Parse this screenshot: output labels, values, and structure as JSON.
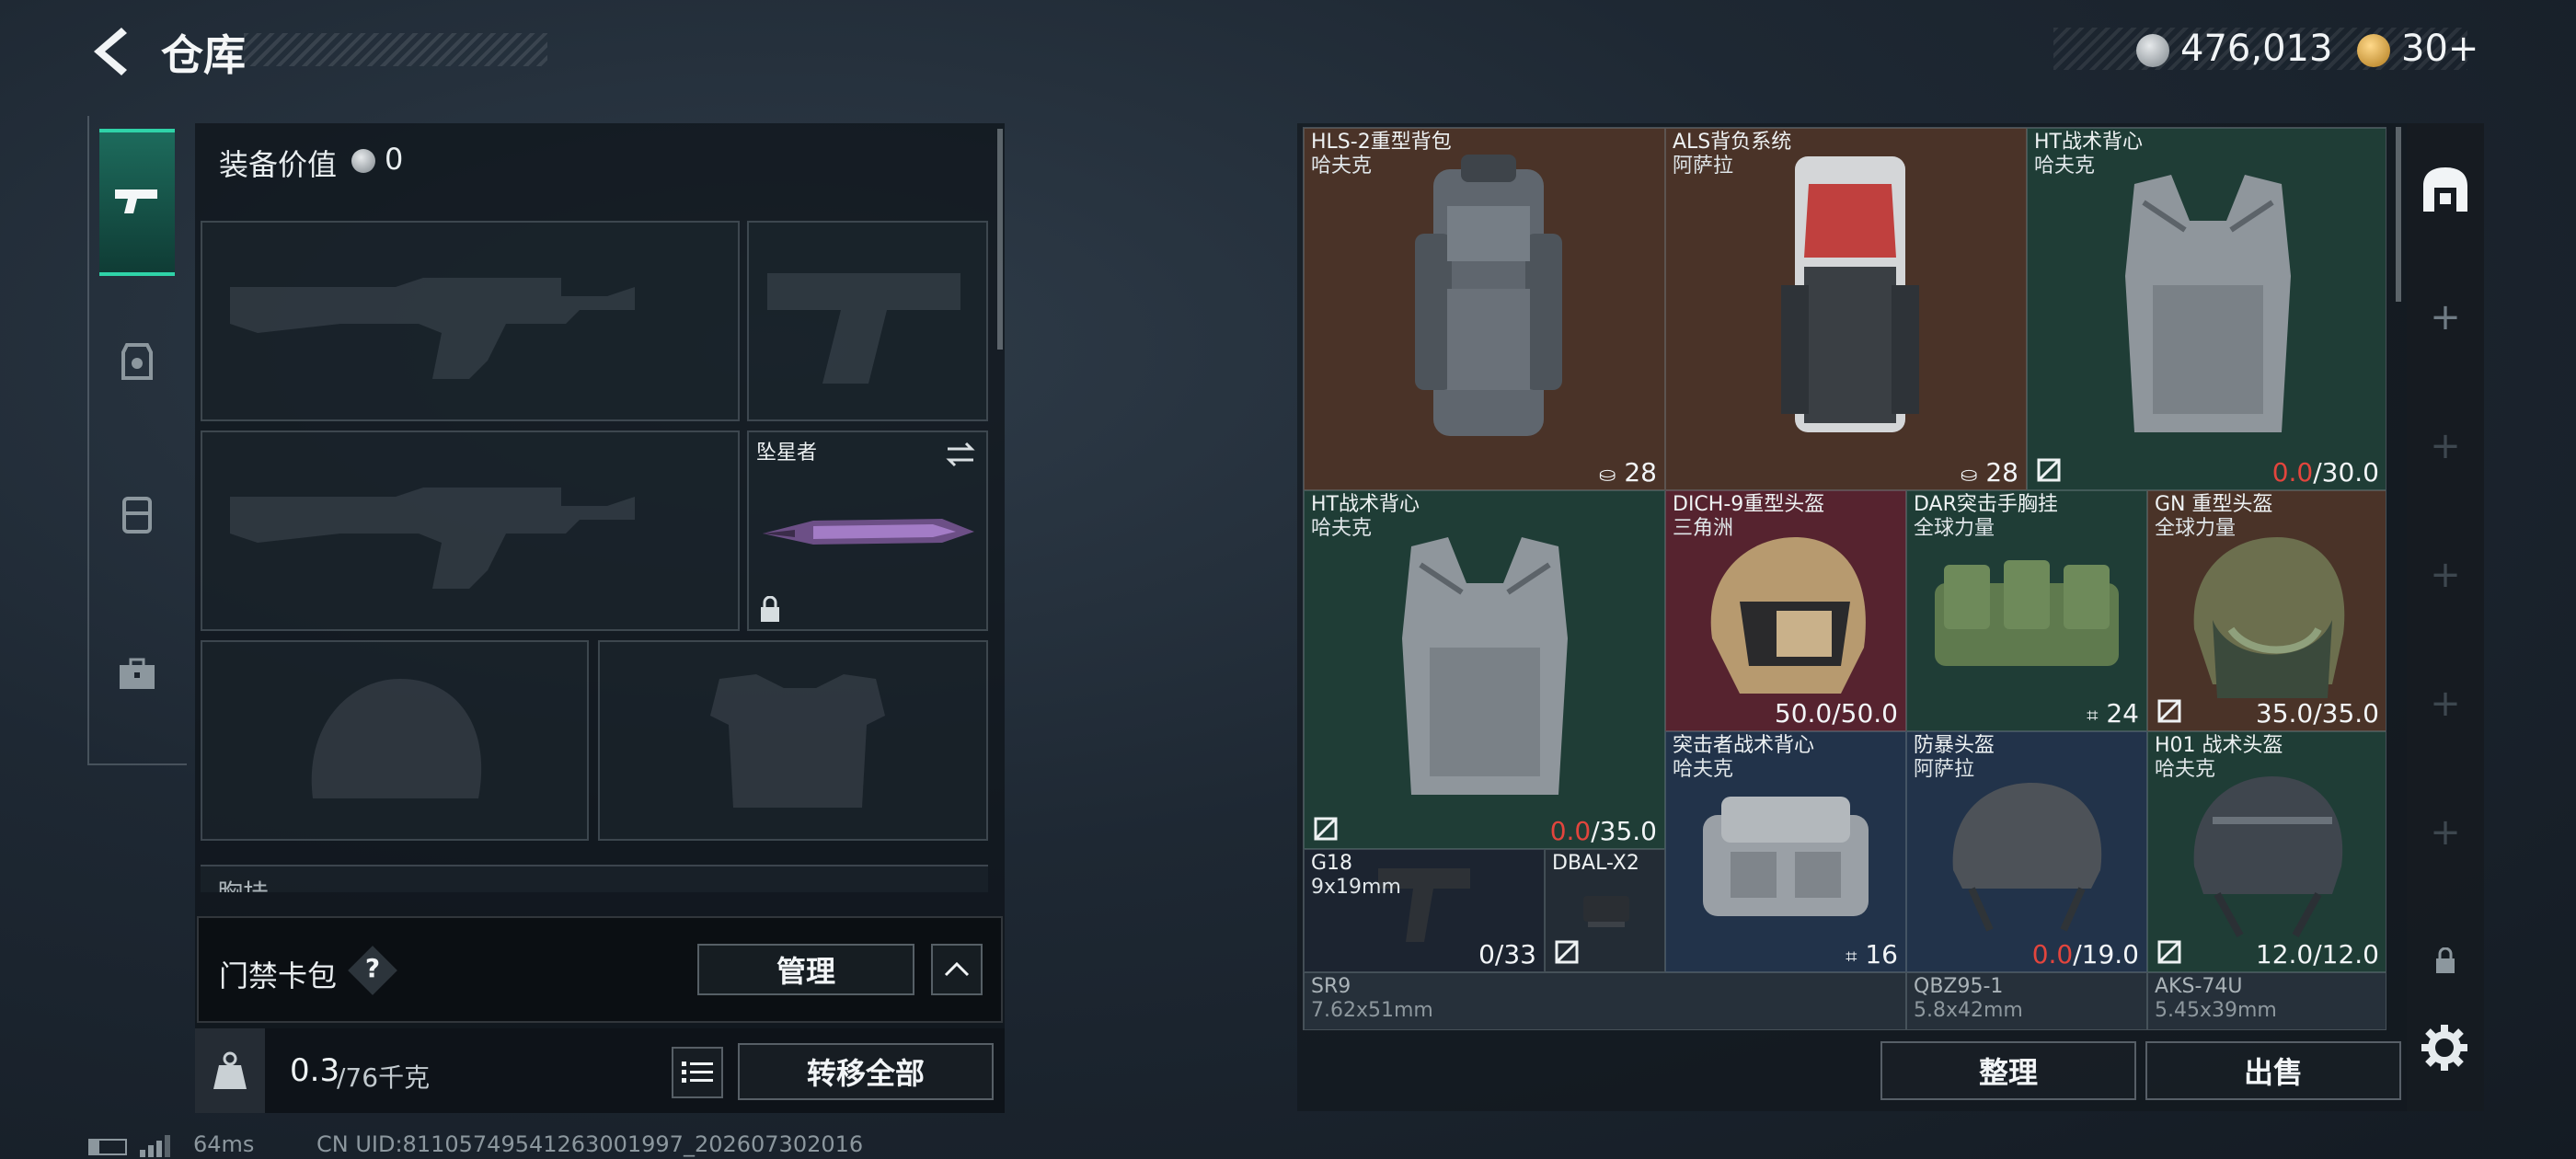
{
  "header": {
    "title": "仓库",
    "currency": "476,013",
    "coins": "30+"
  },
  "loadout": {
    "value_label": "装备价值",
    "value": "0",
    "melee_name": "坠星者",
    "chest_label": "胸挂",
    "card_label": "门禁卡包",
    "help": "?",
    "manage": "管理",
    "weight_current": "0.3",
    "weight_max": "/76千克",
    "transfer_all": "转移全部"
  },
  "grid": {
    "items": [
      {
        "name": "HLS-2重型背包",
        "brand": "哈夫克",
        "count": "28"
      },
      {
        "name": "ALS背负系统",
        "brand": "阿萨拉",
        "count": "28"
      },
      {
        "name": "HT战术背心",
        "brand": "哈夫克",
        "dur_cur": "0.0",
        "dur_max": "/30.0"
      },
      {
        "name": "HT战术背心",
        "brand": "哈夫克",
        "dur_cur": "0.0",
        "dur_max": "/35.0"
      },
      {
        "name": "DICH-9重型头盔",
        "brand": "三角洲",
        "dur": "50.0/50.0"
      },
      {
        "name": "DAR突击手胸挂",
        "brand": "全球力量",
        "count": "24"
      },
      {
        "name": "GN 重型头盔",
        "brand": "全球力量",
        "dur": "35.0/35.0"
      },
      {
        "name": "突击者战术背心",
        "brand": "哈夫克",
        "count": "16"
      },
      {
        "name": "防暴头盔",
        "brand": "阿萨拉",
        "dur_cur": "0.0",
        "dur_max": "/19.0"
      },
      {
        "name": "H01 战术头盔",
        "brand": "哈夫克",
        "dur": "12.0/12.0"
      },
      {
        "name": "G18",
        "brand": "9x19mm",
        "count": "0/33"
      },
      {
        "name": "DBAL-X2"
      },
      {
        "name": "SR9",
        "brand": "7.62x51mm"
      },
      {
        "name": "QBZ95-1",
        "brand": "5.8x42mm"
      },
      {
        "name": "AKS-74U",
        "brand": "5.45x39mm"
      }
    ]
  },
  "actions": {
    "sort": "整理",
    "sell": "出售"
  },
  "footer": {
    "ping": "64ms",
    "uid": "CN UID:81105749541263001997_202607302016"
  },
  "colors": {
    "accent_green": "#2fd3a8",
    "durability_red": "#e2453d"
  },
  "icons": [
    "back-arrow-icon",
    "silver-coin-icon",
    "gold-coin-icon",
    "pistol-icon",
    "armor-icon",
    "backpack-icon",
    "toolbox-icon",
    "swap-icon",
    "lock-icon",
    "weight-icon",
    "list-icon",
    "home-icon",
    "plus-icon",
    "settings-icon",
    "battery-icon",
    "signal-icon"
  ]
}
